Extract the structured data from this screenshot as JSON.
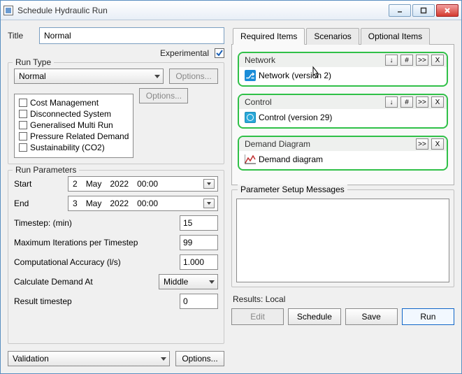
{
  "window": {
    "title": "Schedule Hydraulic Run"
  },
  "titleField": {
    "label": "Title",
    "value": "Normal"
  },
  "experimental": {
    "label": "Experimental",
    "checked": true
  },
  "runType": {
    "legend": "Run Type",
    "value": "Normal",
    "options1": "Options...",
    "options2": "Options...",
    "checks": [
      "Cost Management",
      "Disconnected System",
      "Generalised Multi Run",
      "Pressure Related Demand",
      "Sustainability (CO2)"
    ]
  },
  "params": {
    "legend": "Run Parameters",
    "start": {
      "label": "Start",
      "day": "2",
      "month": "May",
      "year": "2022",
      "time": "00:00"
    },
    "end": {
      "label": "End",
      "day": "3",
      "month": "May",
      "year": "2022",
      "time": "00:00"
    },
    "timestep": {
      "label": "Timestep: (min)",
      "value": "15"
    },
    "maxiter": {
      "label": "Maximum Iterations per Timestep",
      "value": "99"
    },
    "accuracy": {
      "label": "Computational Accuracy (l/s)",
      "value": "1.000"
    },
    "calcAt": {
      "label": "Calculate Demand At",
      "value": "Middle"
    },
    "resultTs": {
      "label": "Result timestep",
      "value": "0"
    }
  },
  "validation": {
    "value": "Validation",
    "options": "Options..."
  },
  "tabs": {
    "required": "Required Items",
    "scenarios": "Scenarios",
    "optional": "Optional Items"
  },
  "cards": {
    "network": {
      "title": "Network",
      "item": "Network (version 2)",
      "btns": {
        "down": "↓",
        "hash": "#",
        "dbl": ">>",
        "x": "X"
      }
    },
    "control": {
      "title": "Control",
      "item": "Control (version 29)",
      "btns": {
        "down": "↓",
        "hash": "#",
        "dbl": ">>",
        "x": "X"
      }
    },
    "demand": {
      "title": "Demand Diagram",
      "item": "Demand diagram",
      "btns": {
        "dbl": ">>",
        "x": "X"
      }
    }
  },
  "messages": {
    "legend": "Parameter Setup Messages"
  },
  "results": {
    "label": "Results: Local"
  },
  "actions": {
    "edit": "Edit",
    "schedule": "Schedule",
    "save": "Save",
    "run": "Run"
  }
}
